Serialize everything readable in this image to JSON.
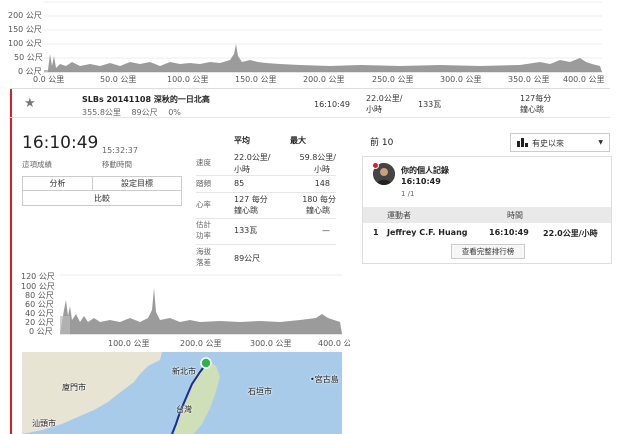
{
  "top_chart": {
    "y_ticks": [
      "200 公尺",
      "150 公尺",
      "100 公尺",
      "50 公尺",
      "0 公尺"
    ],
    "x_ticks": [
      "0.0 公里",
      "50.0 公里",
      "100.0 公里",
      "150.0 公里",
      "200.0 公里",
      "250.0 公里",
      "300.0 公里",
      "350.0 公里",
      "400.0 公里"
    ]
  },
  "segment": {
    "name": "SLBs 20141108 深秋的一日北高",
    "distance": "355.8公里",
    "elevation": "89公尺",
    "grade": "0%",
    "time": "16:10:49",
    "speed_line1": "22.0公里/",
    "speed_line2": "小時",
    "power": "133瓦",
    "hr_line1": "127每分",
    "hr_line2": "鐘心跳"
  },
  "effort": {
    "time": "16:10:49",
    "time_label": "這項成績",
    "elapsed": "15:32:37",
    "elapsed_label": "移動時間",
    "buttons": {
      "analyze": "分析",
      "set_goal": "設定目標",
      "compare": "比較"
    }
  },
  "stats": {
    "head_avg": "平均",
    "head_max": "最大",
    "rows": [
      {
        "label": "速度",
        "avg1": "22.0公里/",
        "avg2": "小時",
        "max1": "59.8公里/",
        "max2": "小時"
      },
      {
        "label": "踏頻",
        "avg1": "85",
        "avg2": "",
        "max1": "148",
        "max2": ""
      },
      {
        "label": "心率",
        "avg1": "127 每分",
        "avg2": "鐘心跳",
        "max1": "180 每分",
        "max2": "鐘心跳"
      },
      {
        "label1": "估計",
        "label2": "功率",
        "avg1": "133瓦",
        "max1": "—"
      },
      {
        "label1": "海拔",
        "label2": "落差",
        "avg1": "89公尺"
      }
    ]
  },
  "mini_chart": {
    "y_ticks": [
      "120 公尺",
      "100 公尺",
      "80 公尺",
      "60 公尺",
      "40 公尺",
      "20 公尺",
      "0 公尺"
    ],
    "x_ticks": [
      "100.0 公里",
      "200.0 公里",
      "300.0 公里",
      "400.0 公里"
    ]
  },
  "map": {
    "labels": {
      "xiamen": "廈門市",
      "shantou": "汕頭市",
      "taipei": "新北市",
      "taiwan": "台灣",
      "ishigaki": "石垣市",
      "miyako": "宮古島"
    }
  },
  "leaderboard": {
    "title": "前 10",
    "filter": "有史以來",
    "pr_title": "你的個人記錄",
    "pr_time": "16:10:49",
    "pr_rank": "1 /1",
    "col_athlete": "運動者",
    "col_time": "時間",
    "rows": [
      {
        "rank": "1",
        "name": "Jeffrey C.F. Huang",
        "time": "16:10:49",
        "speed": "22.0公里/小時"
      }
    ],
    "view_full": "查看完整排行榜"
  },
  "colors": {
    "accent": "#e31b23",
    "elevation": "#8a8a8a",
    "route": "#1a2a9a"
  }
}
